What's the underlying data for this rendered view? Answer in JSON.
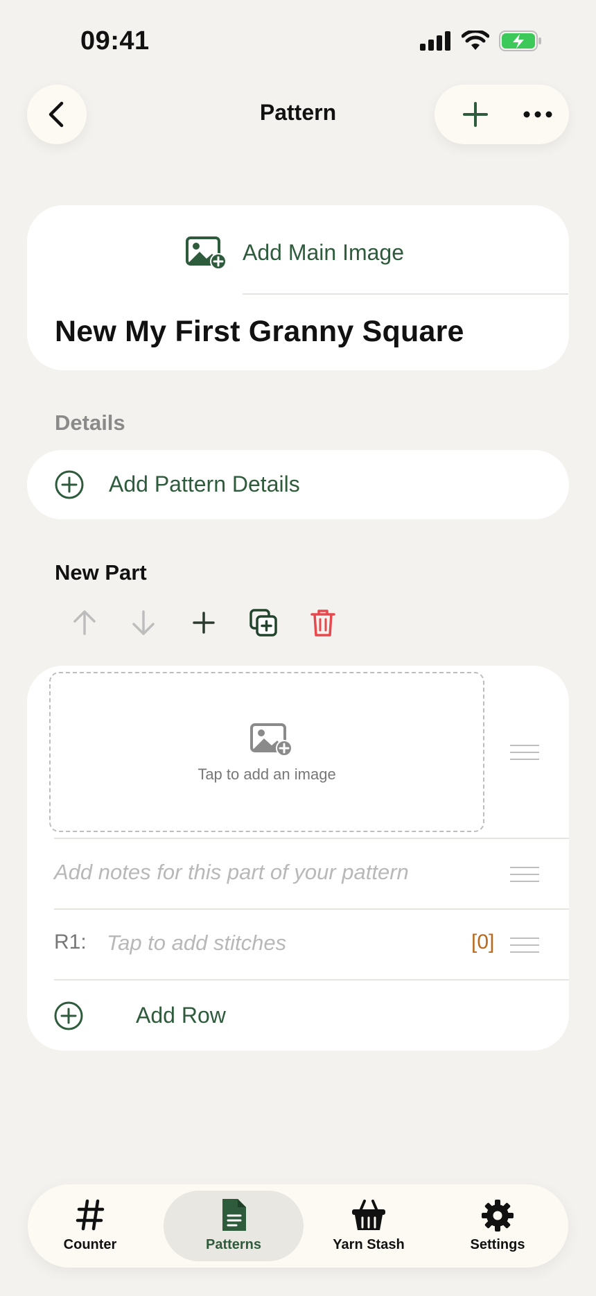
{
  "status_bar": {
    "time": "09:41"
  },
  "nav": {
    "title": "Pattern"
  },
  "main_card": {
    "add_image_label": "Add Main Image",
    "pattern_title": "New My First Granny Square"
  },
  "details": {
    "label": "Details",
    "add_details_label": "Add Pattern Details"
  },
  "part": {
    "title": "New Part",
    "image_placeholder": "Tap to add an image",
    "notes_placeholder": "Add notes for this part of your pattern",
    "rows": [
      {
        "label": "R1:",
        "placeholder": "Tap to add stitches",
        "count": "[0]"
      }
    ],
    "add_row_label": "Add Row"
  },
  "tabs": [
    {
      "label": "Counter",
      "icon": "hash-icon"
    },
    {
      "label": "Patterns",
      "icon": "document-icon",
      "selected": true
    },
    {
      "label": "Yarn Stash",
      "icon": "basket-icon"
    },
    {
      "label": "Settings",
      "icon": "gear-icon"
    }
  ],
  "colors": {
    "accent": "#2E5B3B",
    "danger": "#E5484D",
    "count": "#B86A1E",
    "background": "#F4F2EE"
  }
}
